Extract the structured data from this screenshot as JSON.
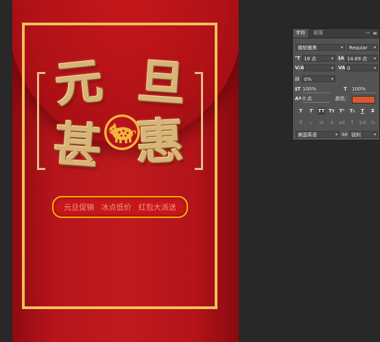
{
  "poster": {
    "headline_chars": [
      "元",
      "旦",
      "甚",
      "惠"
    ],
    "promo_items": [
      "元旦促销",
      "冰点低价",
      "红包大派送"
    ]
  },
  "panel": {
    "tabs": [
      "字符",
      "段落"
    ],
    "collapse": "››",
    "menu": "≡",
    "font_family": "微软雅黑",
    "font_style": "Regular",
    "font_size": "18 点",
    "leading": "14.69 点",
    "kerning": "V/A",
    "tracking": "0",
    "tsume": "0%",
    "vertical_scale": "100%",
    "horizontal_scale": "100%",
    "baseline_shift": "0 点",
    "color_label": "颜色：",
    "style_buttons": [
      "T",
      "T",
      "TT",
      "Tт",
      "T¹",
      "T₁",
      "T",
      "T"
    ],
    "opentype_buttons": [
      "fi",
      "ℴ",
      "st",
      "A",
      "ad",
      "T",
      "1st",
      "½"
    ],
    "language": "美国英语",
    "antialias": "锐利",
    "antialias_icon": "aa"
  },
  "colors": {
    "text_color": "#d9582f",
    "frame": "#f4c25a",
    "promo_border": "#ffb400"
  }
}
